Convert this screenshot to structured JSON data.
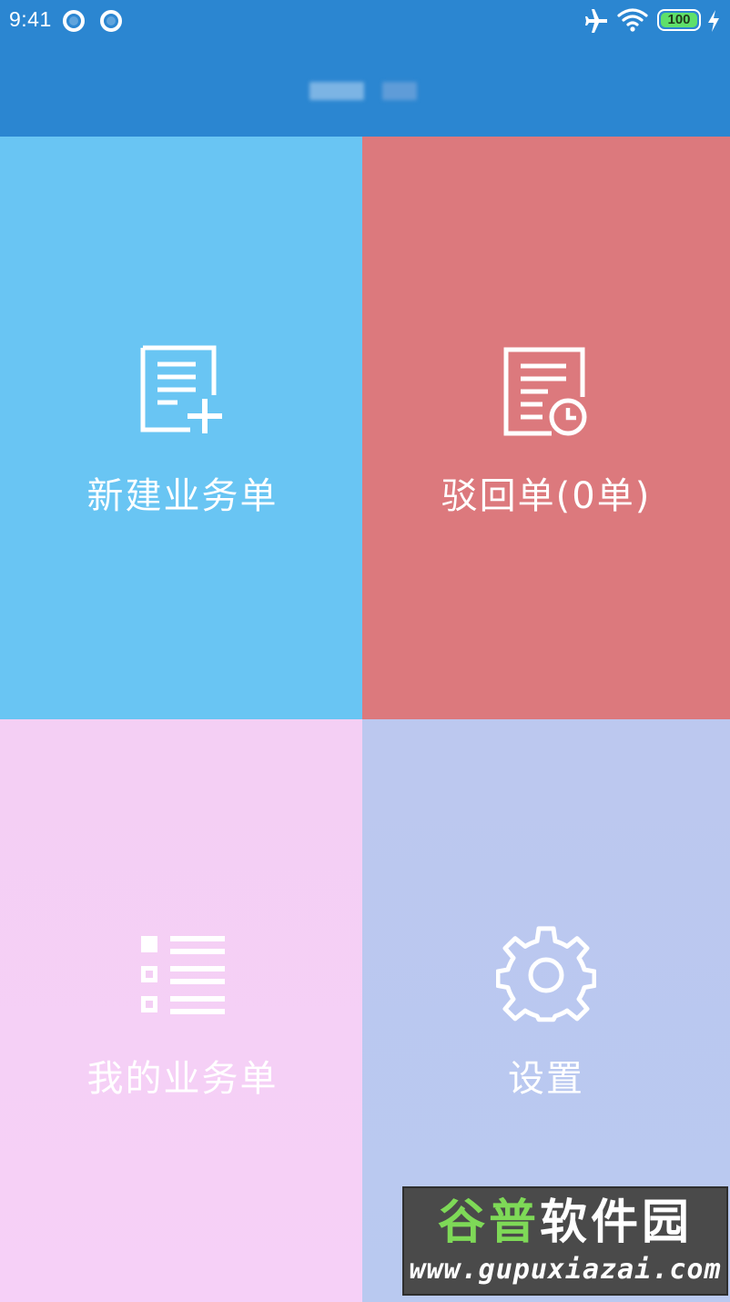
{
  "status_bar": {
    "time": "9:41",
    "battery": "100",
    "icons": [
      "notification-ring-icon",
      "notification-ring-icon",
      "airplane-icon",
      "wifi-icon",
      "battery-icon",
      "charging-bolt-icon"
    ]
  },
  "header": {
    "title_blurred": true
  },
  "tiles": [
    {
      "label": "新建业务单",
      "icon": "new-form-icon",
      "color": "#69C5F3"
    },
    {
      "label": "驳回单(0单)",
      "icon": "rejected-form-clock-icon",
      "color": "#DC797D"
    },
    {
      "label": "我的业务单",
      "icon": "list-icon",
      "color": "#F4CFF4"
    },
    {
      "label": "设置",
      "icon": "gear-icon",
      "color": "#BCC8EF"
    }
  ],
  "watermark": {
    "name_part1": "谷普",
    "name_part2": "软件园",
    "url": "www.gupuxiazai.com"
  }
}
